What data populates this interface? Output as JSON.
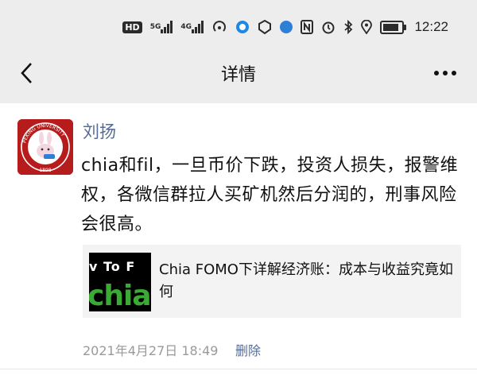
{
  "status_bar": {
    "hd_badge": "HD",
    "net_label_1": "5G",
    "net_label_2": "4G",
    "time": "12:22",
    "battery_level": 0.85,
    "icons": [
      "hd-icon",
      "signal-5g-icon",
      "signal-4g-icon",
      "hotspot-icon",
      "app-icon",
      "shield-icon",
      "blue-app-icon",
      "nfc-icon",
      "alarm-icon",
      "bluetooth-icon",
      "location-icon",
      "battery-icon"
    ]
  },
  "nav": {
    "title": "详情",
    "back_icon": "chevron-left-icon",
    "more_icon": "more-dots-icon"
  },
  "post": {
    "author": "刘扬",
    "avatar_text": "PEKING UNIVERSITY 1898",
    "text": "chia和fil，一旦币价下跌，投资人损失，报警维权，各微信群拉人买矿机然后分润的，刑事风险会很高。",
    "link_card": {
      "thumb_top": "v To F",
      "thumb_bottom": "chia",
      "title": "Chia FOMO下详解经济账：成本与收益究竟如何"
    },
    "timestamp": "2021年4月27日 18:49",
    "delete_label": "删除"
  },
  "colors": {
    "link": "#576b95",
    "header_bg": "#ededed",
    "card_bg": "#f3f3f3",
    "meta": "#9a9a9a",
    "chia_green": "#3aaa35"
  }
}
